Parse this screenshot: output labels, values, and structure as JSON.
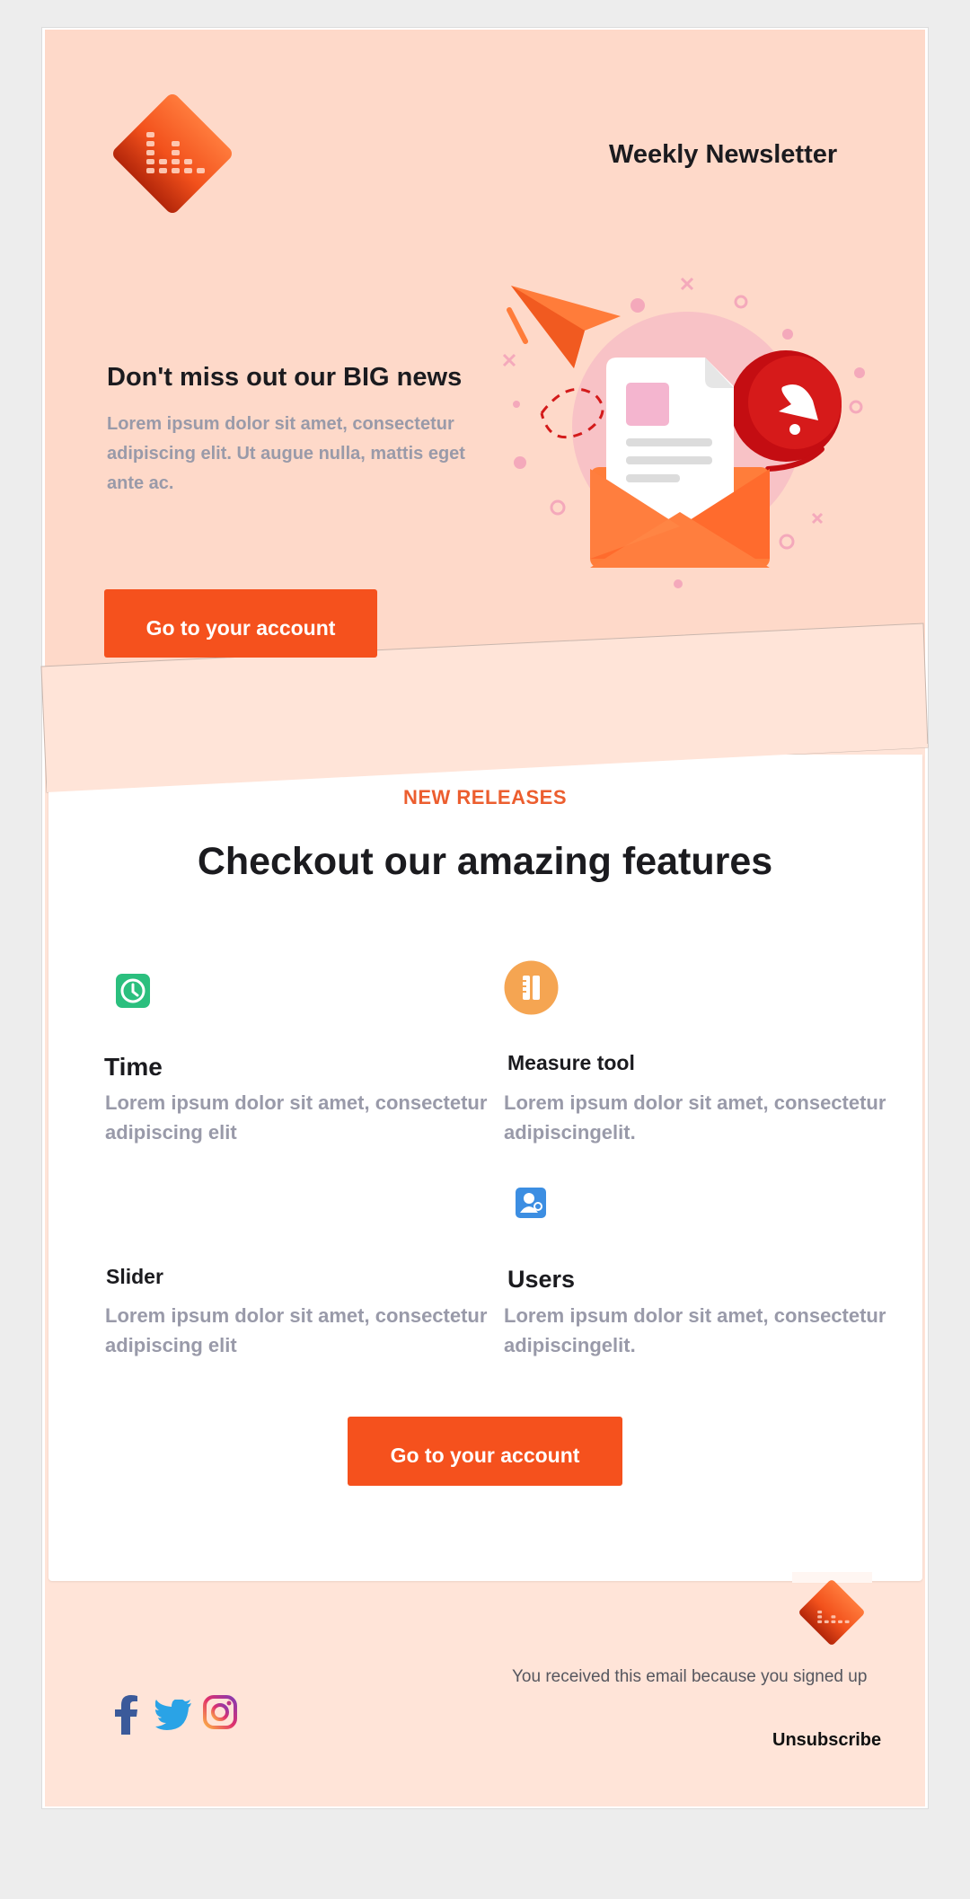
{
  "header": {
    "logo_name": "bar-chart-diamond-logo",
    "title": "Weekly Newsletter"
  },
  "hero": {
    "title": "Don't miss out our BIG news",
    "text": "Lorem ipsum dolor sit amet, consectetur adipiscing elit. Ut augue nulla, mattis eget ante ac.",
    "button_label": "Go to your account",
    "illustration": "newsletter-envelope-illustration"
  },
  "features": {
    "eyebrow": "NEW RELEASES",
    "title": "Checkout our amazing features",
    "items": [
      {
        "title": "Time",
        "text": "Lorem ipsum dolor sit amet, consectetur adipiscing elit",
        "icon": "clock-icon"
      },
      {
        "title": "Measure tool",
        "text": "Lorem ipsum dolor sit amet, consectetur adipiscingelit.",
        "icon": "ruler-icon"
      },
      {
        "title": "Slider",
        "text": "Lorem ipsum dolor sit amet, consectetur adipiscing elit",
        "icon": ""
      },
      {
        "title": "Users",
        "text": "Lorem ipsum dolor sit amet, consectetur adipiscingelit.",
        "icon": "users-icon"
      }
    ],
    "button_label": "Go to your account"
  },
  "footer": {
    "signup_text": "You received this email because you signed up",
    "unsubscribe_label": "Unsubscribe",
    "social": [
      "facebook-icon",
      "twitter-icon",
      "instagram-icon"
    ]
  },
  "colors": {
    "accent": "#f5511d",
    "peach": "#fed9c9",
    "peach_light": "#ffe4d8",
    "text_dark": "#1b1b1f",
    "text_muted": "#999aa9"
  }
}
